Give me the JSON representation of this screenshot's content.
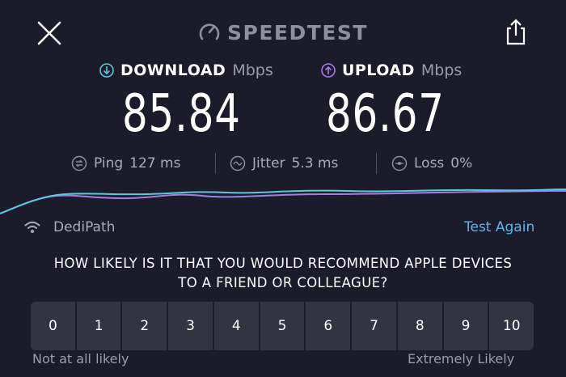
{
  "header": {
    "brand": "SPEEDTEST",
    "close_icon": "close-icon",
    "share_icon": "share-icon"
  },
  "download": {
    "label": "DOWNLOAD",
    "unit": "Mbps",
    "value": "85.84",
    "color": "#5cc9d8"
  },
  "upload": {
    "label": "UPLOAD",
    "unit": "Mbps",
    "value": "86.67",
    "color": "#a77de0"
  },
  "stats": {
    "ping": {
      "label": "Ping",
      "value": "127 ms"
    },
    "jitter": {
      "label": "Jitter",
      "value": "5.3 ms"
    },
    "loss": {
      "label": "Loss",
      "value": "0%"
    }
  },
  "server": {
    "name": "DediPath",
    "icon": "wifi-icon"
  },
  "test_again": "Test Again",
  "survey": {
    "question_line1": "HOW LIKELY IS IT THAT YOU WOULD RECOMMEND APPLE DEVICES",
    "question_line2": "TO A FRIEND OR COLLEAGUE?",
    "options": [
      "0",
      "1",
      "2",
      "3",
      "4",
      "5",
      "6",
      "7",
      "8",
      "9",
      "10"
    ],
    "low_label": "Not at all likely",
    "high_label": "Extremely Likely"
  }
}
